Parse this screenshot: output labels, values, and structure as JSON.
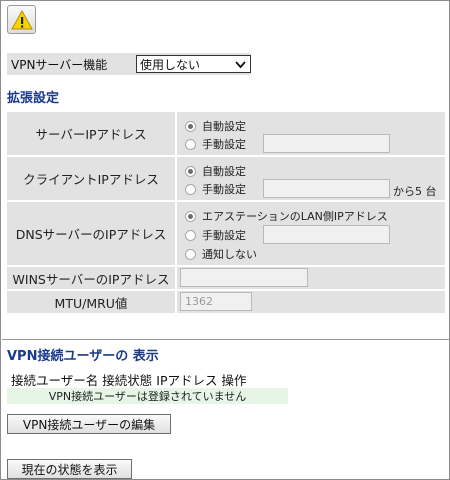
{
  "colors": {
    "accent": "#1a3a8c",
    "row_bg": "#e2e2e2",
    "users_empty_bg": "#e7f5e7"
  },
  "vpn_server": {
    "label": "VPNサーバー機能",
    "selected": "使用しない"
  },
  "extended": {
    "title": "拡張設定",
    "server_ip": {
      "label": "サーバーIPアドレス",
      "auto": "自動設定",
      "manual": "手動設定",
      "selected": "auto",
      "value": ""
    },
    "client_ip": {
      "label": "クライアントIPアドレス",
      "auto": "自動設定",
      "manual": "手動設定",
      "selected": "auto",
      "value": "",
      "suffix": "から5 台"
    },
    "dns_ip": {
      "label": "DNSサーバーのIPアドレス",
      "station": "エアステーションのLAN側IPアドレス",
      "manual": "手動設定",
      "none": "通知しない",
      "selected": "station",
      "value": ""
    },
    "wins_ip": {
      "label": "WINSサーバーのIPアドレス",
      "value": ""
    },
    "mtu": {
      "label": "MTU/MRU値",
      "value": "1362"
    }
  },
  "users": {
    "title": "VPN接続ユーザーの 表示",
    "columns": [
      "接続ユーザー名",
      "接続状態",
      "IPアドレス",
      "操作"
    ],
    "empty_message": "VPN接続ユーザーは登録されていません",
    "edit_button": "VPN接続ユーザーの編集"
  },
  "status_button": "現在の状態を表示",
  "icons": {
    "warning": "warning-icon",
    "dropdown": "chevron-down-icon"
  }
}
